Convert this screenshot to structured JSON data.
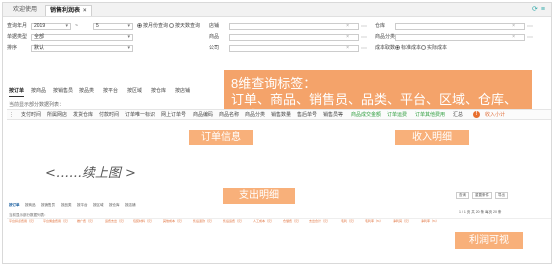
{
  "tabbar": {
    "home_label": "欢迎使用",
    "active_label": "销售利润表",
    "close": "×",
    "tools": [
      "⟳",
      "≡"
    ]
  },
  "filters": {
    "period_label": "查询年月",
    "year": "2019",
    "sep": "~",
    "month": "5",
    "radio_period": "按月份查询",
    "radio_time": "按天数查询",
    "store_label": "店铺",
    "store_value": "",
    "warehouse_label": "仓库",
    "warehouse_value": "",
    "order_type_label": "单据类型",
    "order_type_value": "全部",
    "goods_label": "商品",
    "goods_value": "",
    "goods_cat_label": "商品分类",
    "goods_cat_value": "",
    "sort_label": "排序",
    "sort_value": "默认",
    "company_label": "公司",
    "company_value": "",
    "cost_label": "成本取数",
    "cost_opt1": "标准成本",
    "cost_opt2": "实际成本",
    "clear": "×",
    "more": "⋯",
    "dropdown": "▾"
  },
  "callout": {
    "line1": "8维查询标签：",
    "line2": "订单、商品、销售员、品类、平台、区域、仓库、店铺"
  },
  "subtabs": [
    "按订单",
    "按商品",
    "按销售员",
    "按品类",
    "按平台",
    "按区域",
    "按仓库",
    "按店铺"
  ],
  "hint": "当前显示部分数据列表：",
  "header_cols": [
    {
      "t": "⋮",
      "c": ""
    },
    {
      "t": "支付时间",
      "c": ""
    },
    {
      "t": "所属网店",
      "c": ""
    },
    {
      "t": "发货仓库",
      "c": ""
    },
    {
      "t": "付款时间",
      "c": ""
    },
    {
      "t": "订单唯一标识",
      "c": ""
    },
    {
      "t": "网上订单号",
      "c": ""
    },
    {
      "t": "商品编码",
      "c": ""
    },
    {
      "t": "商品名称",
      "c": ""
    },
    {
      "t": "商品分类",
      "c": ""
    },
    {
      "t": "销售数量",
      "c": ""
    },
    {
      "t": "售后单号",
      "c": ""
    },
    {
      "t": "销售员等",
      "c": ""
    },
    {
      "t": "商品成交金额",
      "c": "g"
    },
    {
      "t": "订单运费",
      "c": "g"
    },
    {
      "t": "订单其他费用",
      "c": "g"
    },
    {
      "t": "汇总",
      "c": ""
    },
    {
      "t": "收入小计",
      "c": "o"
    }
  ],
  "warn_icon": "!",
  "sections": {
    "order": "订单信息",
    "income": "收入明细",
    "expense": "支出明细",
    "profit": "利润可视"
  },
  "continue_text": "<……续上图 >",
  "bottom": {
    "tabs": [
      "按订单",
      "按商品",
      "按销售员",
      "按品类",
      "按平台",
      "按区域",
      "按仓库",
      "按店铺"
    ],
    "buttons": [
      "查询",
      "重置条件",
      "导出"
    ],
    "hint": "当前显示部分数据列表：",
    "pager": "1 / 1  页  共 20 条  每页 20 条",
    "cols": [
      "平台扣点费用（元）",
      "平台佣金费用（元）",
      "推广费（元）",
      "运费支出（元）",
      "包装材料（元）",
      "其他成本（元）",
      "售后退款（元）",
      "售后运费（元）",
      "人工成本（元）",
      "仓储费（元）",
      "支出合计（元）",
      "毛利（元）",
      "毛利率（%）",
      "净利润（元）",
      "净利率（%）"
    ]
  }
}
